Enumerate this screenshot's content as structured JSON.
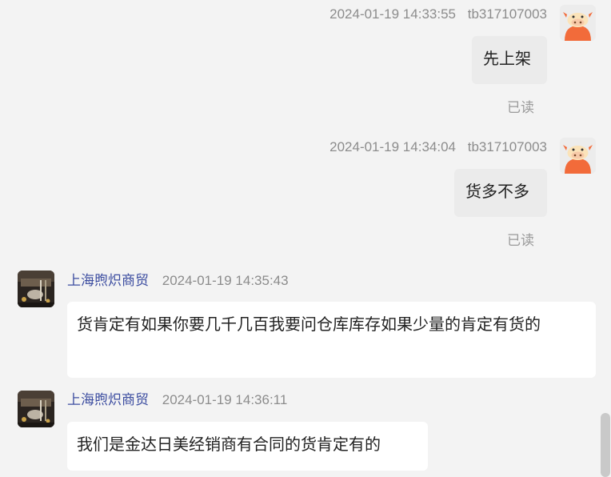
{
  "messages": [
    {
      "side": "right",
      "timestamp": "2024-01-19 14:33:55",
      "sender": "tb317107003",
      "text": "先上架",
      "status": "已读"
    },
    {
      "side": "right",
      "timestamp": "2024-01-19 14:34:04",
      "sender": "tb317107003",
      "text": "货多不多",
      "status": "已读"
    },
    {
      "side": "left",
      "sender": "上海煦炽商贸",
      "timestamp": "2024-01-19 14:35:43",
      "text": "货肯定有如果你要几千几百我要问仓库库存如果少量的肯定有货的"
    },
    {
      "side": "left",
      "sender": "上海煦炽商贸",
      "timestamp": "2024-01-19 14:36:11",
      "text": "我们是金达日美经销商有合同的货肯定有的"
    }
  ],
  "colors": {
    "background": "#f3f3f3",
    "seller_name": "#3c4da0",
    "meta_text": "#8c8c8c",
    "buyer_bubble": "#ebebeb",
    "seller_bubble": "#ffffff",
    "avatar_buyer_accent": "#f26b3a"
  },
  "icons": {
    "buyer_avatar": "orange-cow-mascot-icon",
    "seller_avatar": "shop-photo-avatar"
  }
}
